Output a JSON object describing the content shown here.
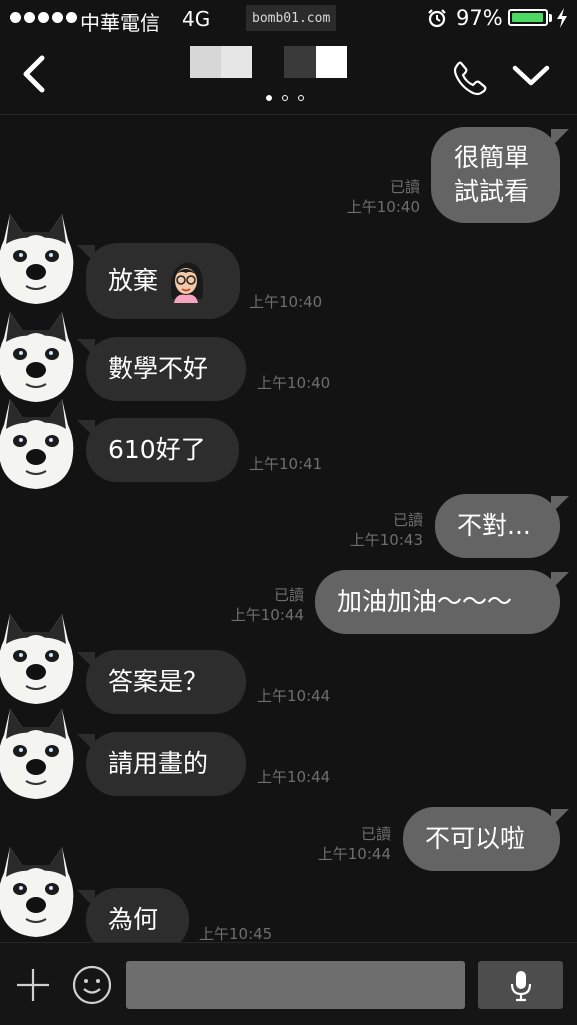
{
  "status_bar": {
    "carrier": "中華電信",
    "network": "4G",
    "time_watermark": "bomb01.com",
    "battery_percent": "97%",
    "battery_level": 0.97,
    "icons": [
      "signal-dots",
      "alarm-icon",
      "battery-icon",
      "charging-icon"
    ]
  },
  "header": {
    "page_indicator": {
      "count": 3,
      "active": 1
    },
    "icons": [
      "back-chevron-icon",
      "call-icon",
      "collapse-chevron-icon"
    ]
  },
  "messages": [
    {
      "side": "sent",
      "text": "很簡單\n試試看",
      "read": "已讀",
      "time": "上午10:40"
    },
    {
      "side": "recv",
      "text": "放棄",
      "sticker": "girl-sticker-icon",
      "time": "上午10:40"
    },
    {
      "side": "recv",
      "text": "數學不好",
      "time": "上午10:40"
    },
    {
      "side": "recv",
      "text": "610好了",
      "time": "上午10:41"
    },
    {
      "side": "sent",
      "text": "不對...",
      "read": "已讀",
      "time": "上午10:43"
    },
    {
      "side": "sent",
      "text": "加油加油～～～",
      "read": "已讀",
      "time": "上午10:44"
    },
    {
      "side": "recv",
      "text": "答案是？",
      "time": "上午10:44"
    },
    {
      "side": "recv",
      "text": "請用畫的",
      "time": "上午10:44"
    },
    {
      "side": "sent",
      "text": "不可以啦",
      "read": "已讀",
      "time": "上午10:44"
    },
    {
      "side": "recv",
      "text": "為何",
      "time": "上午10:45"
    }
  ],
  "input_bar": {
    "message_value": "",
    "icons": [
      "plus-icon",
      "emoji-icon",
      "mic-icon"
    ]
  },
  "colors": {
    "background": "#131313",
    "sent_bubble": "#646464",
    "received_bubble": "#2d2d2d",
    "meta_text": "#6e6e6e",
    "battery": "#4cd964"
  }
}
